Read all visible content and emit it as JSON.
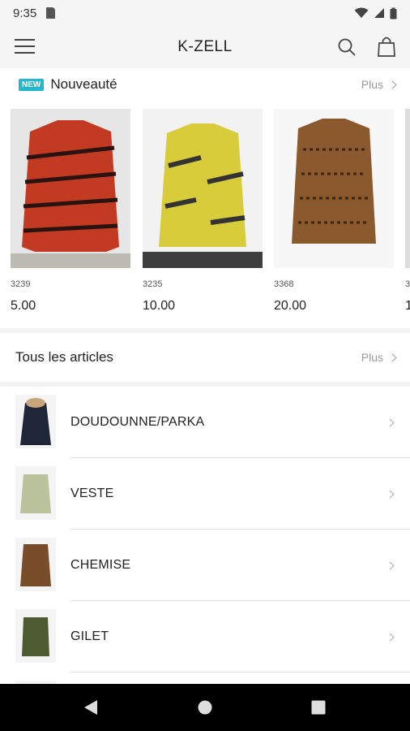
{
  "status_bar": {
    "time": "9:35"
  },
  "app_bar": {
    "title": "K-ZELL"
  },
  "new_section": {
    "badge": "NEW",
    "title": "Nouveauté",
    "more": "Plus",
    "products": [
      {
        "code": "3239",
        "price": "5.00",
        "color": "#c23a22"
      },
      {
        "code": "3235",
        "price": "10.00",
        "color": "#d8cc3a"
      },
      {
        "code": "3368",
        "price": "20.00",
        "color": "#8a5a2e"
      },
      {
        "code": "3",
        "price": "1",
        "color": "#dddddd"
      }
    ]
  },
  "all_section": {
    "title": "Tous les articles",
    "more": "Plus"
  },
  "categories": [
    {
      "label": "DOUDOUNNE/PARKA",
      "color": "#1e2638"
    },
    {
      "label": "VESTE",
      "color": "#b9c29a"
    },
    {
      "label": "CHEMISE",
      "color": "#7a4d2a"
    },
    {
      "label": "GILET",
      "color": "#4e5a30"
    }
  ]
}
